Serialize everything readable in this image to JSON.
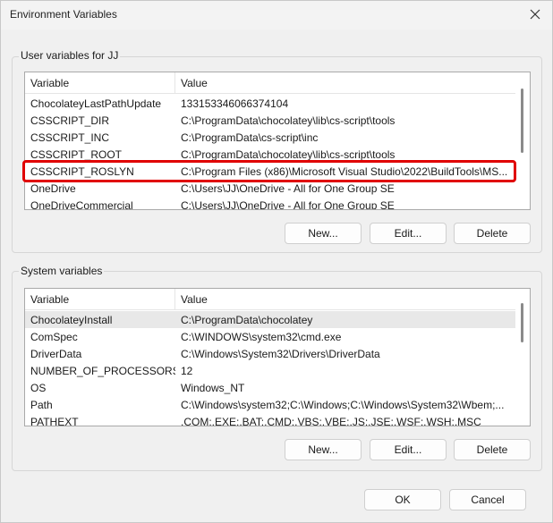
{
  "window": {
    "title": "Environment Variables",
    "close_icon": "close-icon"
  },
  "user_vars": {
    "group_label": "User variables for JJ",
    "header": {
      "col_variable": "Variable",
      "col_value": "Value"
    },
    "rows": [
      {
        "variable": "ChocolateyLastPathUpdate",
        "value": "133153346066374104"
      },
      {
        "variable": "CSSCRIPT_DIR",
        "value": "C:\\ProgramData\\chocolatey\\lib\\cs-script\\tools"
      },
      {
        "variable": "CSSCRIPT_INC",
        "value": "C:\\ProgramData\\cs-script\\inc"
      },
      {
        "variable": "CSSCRIPT_ROOT",
        "value": "C:\\ProgramData\\chocolatey\\lib\\cs-script\\tools"
      },
      {
        "variable": "CSSCRIPT_ROSLYN",
        "value": "C:\\Program Files (x86)\\Microsoft Visual Studio\\2022\\BuildTools\\MS..."
      },
      {
        "variable": "OneDrive",
        "value": "C:\\Users\\JJ\\OneDrive - All for One Group SE"
      },
      {
        "variable": "OneDriveCommercial",
        "value": "C:\\Users\\JJ\\OneDrive - All for One Group SE"
      }
    ],
    "buttons": {
      "new": "New...",
      "edit": "Edit...",
      "delete": "Delete"
    }
  },
  "system_vars": {
    "group_label": "System variables",
    "header": {
      "col_variable": "Variable",
      "col_value": "Value"
    },
    "rows": [
      {
        "variable": "ChocolateyInstall",
        "value": "C:\\ProgramData\\chocolatey"
      },
      {
        "variable": "ComSpec",
        "value": "C:\\WINDOWS\\system32\\cmd.exe"
      },
      {
        "variable": "DriverData",
        "value": "C:\\Windows\\System32\\Drivers\\DriverData"
      },
      {
        "variable": "NUMBER_OF_PROCESSORS",
        "value": "12"
      },
      {
        "variable": "OS",
        "value": "Windows_NT"
      },
      {
        "variable": "Path",
        "value": "C:\\Windows\\system32;C:\\Windows;C:\\Windows\\System32\\Wbem;..."
      },
      {
        "variable": "PATHEXT",
        "value": ".COM;.EXE;.BAT;.CMD;.VBS;.VBE;.JS;.JSE;.WSF;.WSH;.MSC"
      }
    ],
    "buttons": {
      "new": "New...",
      "edit": "Edit...",
      "delete": "Delete"
    }
  },
  "dialog_buttons": {
    "ok": "OK",
    "cancel": "Cancel"
  },
  "colors": {
    "highlight": "#e00000",
    "selected_row": "#e8e8e8"
  }
}
